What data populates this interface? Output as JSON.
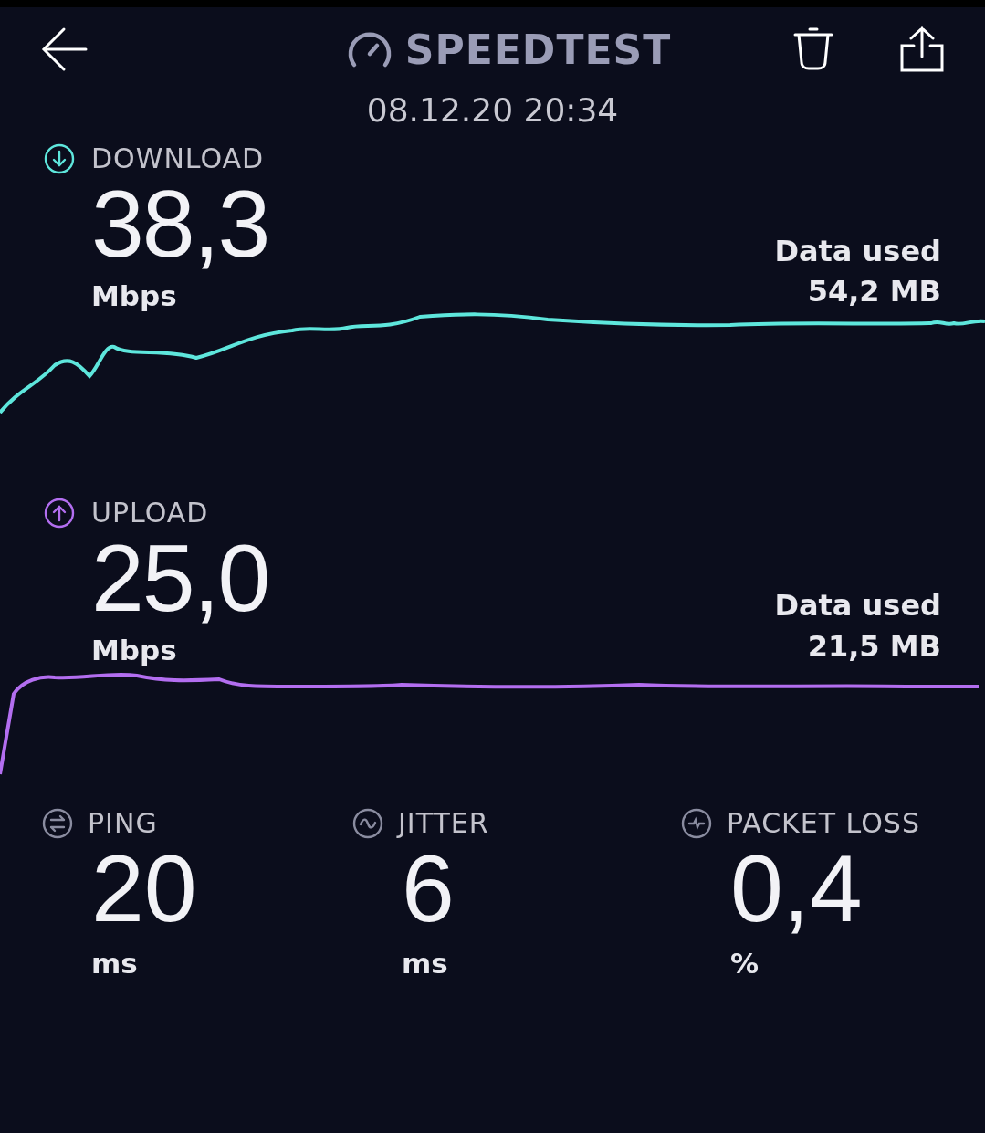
{
  "header": {
    "title": "SPEEDTEST",
    "timestamp": "08.12.20 20:34"
  },
  "tests": [
    {
      "kind": "download",
      "label": "DOWNLOAD",
      "value": "38,3",
      "unit": "Mbps",
      "data_label": "Data used",
      "data_value": "54,2 MB",
      "color": "#5ee6dc"
    },
    {
      "kind": "upload",
      "label": "UPLOAD",
      "value": "25,0",
      "unit": "Mbps",
      "data_label": "Data used",
      "data_value": "21,5 MB",
      "color": "#b36ef0"
    }
  ],
  "metrics": [
    {
      "kind": "ping",
      "label": "PING",
      "value": "20",
      "unit": "ms"
    },
    {
      "kind": "jitter",
      "label": "JITTER",
      "value": "6",
      "unit": "ms"
    },
    {
      "kind": "packet_loss",
      "label": "PACKET LOSS",
      "value": "0,4",
      "unit": "%"
    }
  ]
}
